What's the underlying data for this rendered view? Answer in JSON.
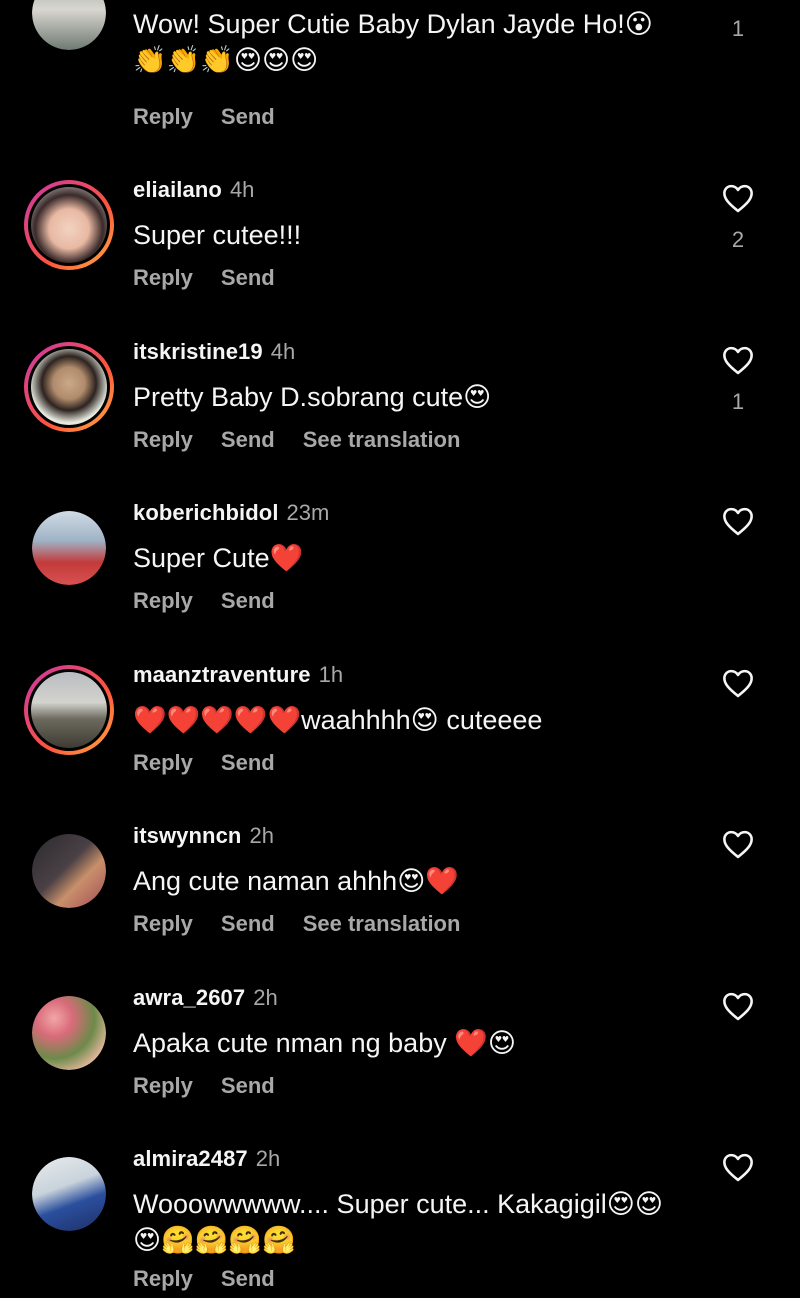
{
  "comments": [
    {
      "user": "",
      "time": "",
      "text": "Wow! Super  Cutie Baby Dylan Jayde Ho!😮",
      "text2": "👏👏👏😍😍😍",
      "reply": "Reply",
      "send": "Send",
      "translate": "",
      "likes": "1"
    },
    {
      "user": "eliailano",
      "time": "4h",
      "text": "Super cutee!!!",
      "reply": "Reply",
      "send": "Send",
      "translate": "",
      "likes": "2"
    },
    {
      "user": "itskristine19",
      "time": "4h",
      "text": "Pretty Baby D.sobrang cute😍",
      "reply": "Reply",
      "send": "Send",
      "translate": "See translation",
      "likes": "1"
    },
    {
      "user": "koberichbidol",
      "time": "23m",
      "text": "Super Cute❤️",
      "reply": "Reply",
      "send": "Send",
      "translate": "",
      "likes": ""
    },
    {
      "user": "maanztraventure",
      "time": "1h",
      "text": "❤️❤️❤️❤️❤️waahhhh😍 cuteeee",
      "reply": "Reply",
      "send": "Send",
      "translate": "",
      "likes": ""
    },
    {
      "user": "itswynncn",
      "time": "2h",
      "text": "Ang cute naman ahhh😍❤️",
      "reply": "Reply",
      "send": "Send",
      "translate": "See translation",
      "likes": ""
    },
    {
      "user": "awra_2607",
      "time": "2h",
      "text": "Apaka cute nman ng baby ❤️😍",
      "reply": "Reply",
      "send": "Send",
      "translate": "",
      "likes": ""
    },
    {
      "user": "almira2487",
      "time": "2h",
      "text": "Wooowwwww.... Super cute... Kakagigil😍😍",
      "text2": "😍🤗🤗🤗🤗",
      "reply": "Reply",
      "send": "Send",
      "translate": "",
      "likes": ""
    }
  ],
  "colors": {
    "background": "#000000",
    "text": "#f5f5f5",
    "secondary": "#a8a8a8",
    "ring_start": "#c837ab",
    "ring_end": "#ffb13d"
  },
  "icons": {
    "like": "heart-outline-icon"
  }
}
